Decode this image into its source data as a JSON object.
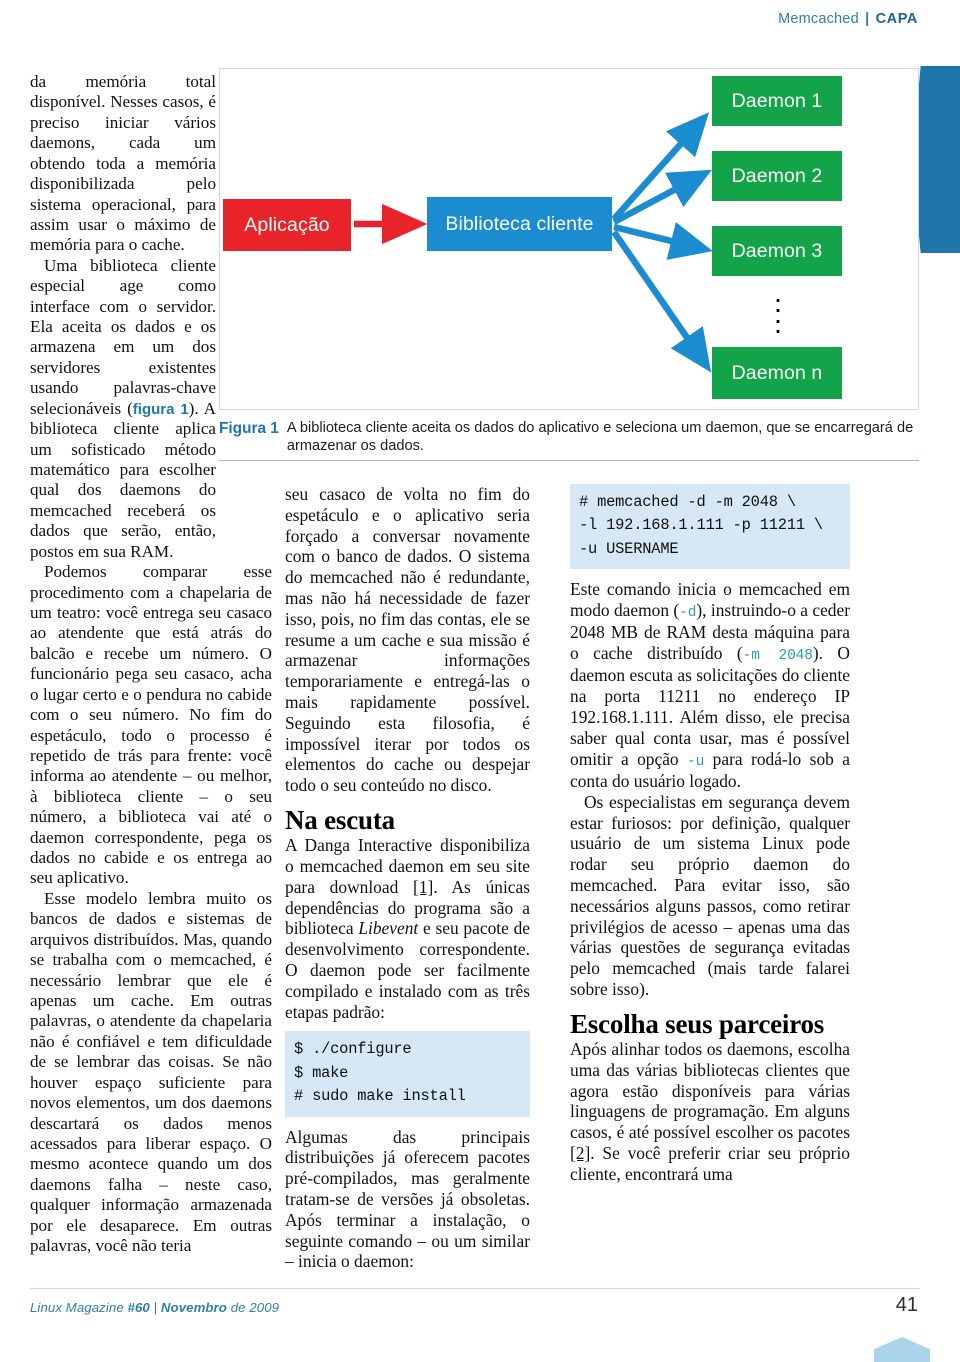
{
  "runhead": {
    "topic": "Memcached",
    "separator": "|",
    "section": "CAPA"
  },
  "figure": {
    "nodes": {
      "app": "Aplicação",
      "library": "Biblioteca cliente",
      "daemon1": "Daemon 1",
      "daemon2": "Daemon 2",
      "daemon3": "Daemon 3",
      "daemonN": "Daemon n",
      "ellipsis": "⋮"
    },
    "caption_label": "Figura 1",
    "caption_text": "A biblioteca cliente aceita os dados do aplicativo e seleciona um daemon, que se encarregará de armazenar os dados.",
    "colors": {
      "app": "#e8232a",
      "library": "#1b8cd0",
      "daemon": "#13a44a",
      "arrow_red": "#e8232a",
      "arrow_blue": "#1b8cd0"
    }
  },
  "left_column": {
    "p1_a": "da memória total disponível. Nesses casos, é preciso iniciar vários daemons, cada um obtendo toda a memória disponibilizada pelo sistema operacional, para assim usar o máximo de memória para o cache.",
    "p2_a": "Uma biblioteca cliente especial age como interface com o servidor. Ela aceita os dados e os armazena em um dos servidores existentes usando palavras-chave selecionáveis (",
    "p2_figref": "figura 1",
    "p2_b": "). A biblioteca cliente aplica um sofisticado método matemático para escolher qual dos daemons do memcached receberá os dados que serão, então, postos em sua RAM.",
    "p3": "Podemos comparar esse procedimento com a chapelaria de um teatro: você entrega seu casaco ao atendente que está atrás do balcão e recebe um número. O funcionário pega seu casaco, acha o lugar certo e o pendura no cabide com o seu número. No fim do espetáculo, todo o processo é repetido de trás para frente: você informa ao atendente – ou melhor, à biblioteca cliente – o seu número, a biblioteca vai até o daemon correspondente, pega os dados no cabide e os entrega ao seu aplicativo.",
    "p4": "Esse modelo lembra muito os bancos de dados e sistemas de arquivos distribuídos. Mas, quando se trabalha com o memcached, é necessário lembrar que ele é apenas um cache. Em outras palavras, o atendente da chapelaria não é confiável e tem dificuldade de se lembrar das coisas. Se não houver espaço suficiente para novos elementos, um dos daemons descartará os dados menos acessados para liberar espaço. O mesmo acontece quando um dos daemons falha – neste caso, qualquer informação armazenada por ele desaparece. Em outras palavras, você não teria"
  },
  "middle_column": {
    "p1": "seu casaco de volta no fim do espetáculo e o aplicativo seria forçado a conversar novamente com o banco de dados. O sistema do memcached não é redundante, mas não há necessidade de fazer isso, pois, no fim das contas, ele se resume a um cache e sua missão é armazenar informações temporariamente e entregá-las o mais rapidamente possível. Seguindo esta filosofia, é impossível iterar por todos os elementos do cache ou despejar todo o seu conteúdo no disco.",
    "heading": "Na escuta",
    "p2_a": "A Danga Interactive disponibiliza o memcached daemon em seu site para download ",
    "p2_ref": "[1]",
    "p2_b": ". As únicas dependências do programa são a biblioteca ",
    "p2_ital": "Libevent",
    "p2_c": " e seu pacote de desenvolvimento correspondente. O daemon pode ser facilmente compilado e instalado com as três etapas padrão:",
    "code": "$ ./configure\n$ make\n# sudo make install",
    "p3": "Algumas das principais distribuições já oferecem pacotes pré-compilados, mas geralmente tratam-se de versões já obsoletas. Após terminar a instalação, o seguinte comando – ou um similar – inicia o daemon:"
  },
  "right_column": {
    "code": "# memcached -d -m 2048 \\\n-l 192.168.1.111 -p 11211 \\\n-u USERNAME",
    "p1_a": "Este comando inicia o memcached em modo daemon (",
    "p1_code1": "-d",
    "p1_b": "), instruindo-o a ceder 2048 MB de RAM desta máquina para o cache distribuído (",
    "p1_code2": "-m 2048",
    "p1_c": "). O daemon escuta as solicitações do cliente na porta 11211 no endereço IP 192.168.1.111. Além disso, ele precisa saber qual conta usar, mas é possível omitir a opção ",
    "p1_code3": "-u",
    "p1_d": " para rodá-lo sob a conta do usuário logado.",
    "p2": "Os especialistas em segurança devem estar furiosos: por definição, qualquer usuário de um sistema Linux pode rodar seu próprio daemon do memcached. Para evitar isso, são necessários alguns passos, como retirar privilégios de acesso – apenas uma das várias questões de segurança evitadas pelo memcached (mais tarde falarei sobre isso).",
    "heading": "Escolha seus parceiros",
    "p3_a": "Após alinhar todos os daemons, escolha uma das várias bibliotecas clientes que agora estão disponíveis para várias linguagens de programação. Em alguns casos, é até possível escolher os pacotes ",
    "p3_ref": "[2]",
    "p3_b": ". Se você preferir criar seu próprio cliente, encontrará uma"
  },
  "footer": {
    "magazine": "Linux Magazine ",
    "issue": "#60",
    "sep": " | ",
    "month": "Novembro",
    "year": " de 2009",
    "page_number": "41"
  }
}
